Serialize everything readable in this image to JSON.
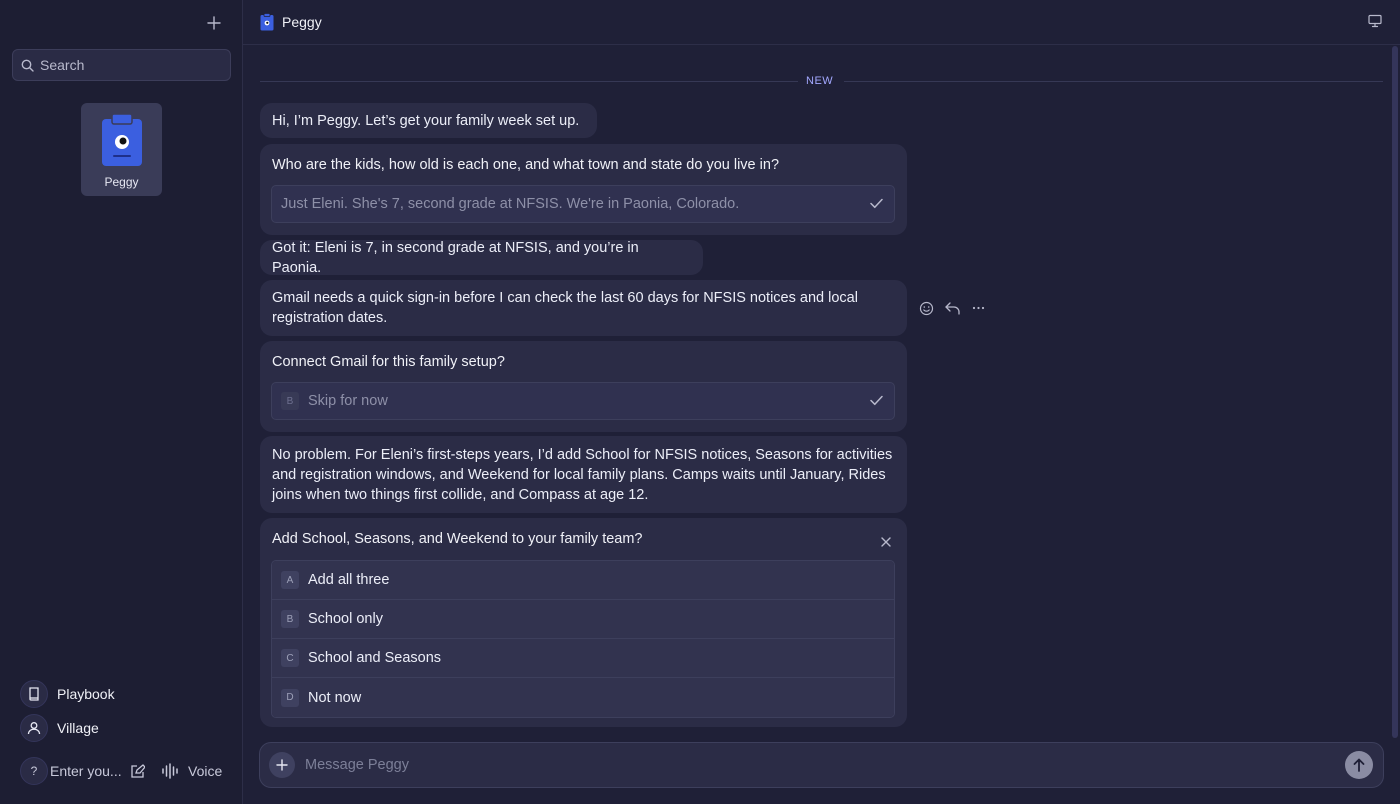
{
  "sidebar": {
    "search_placeholder": "Search",
    "agent": {
      "name": "Peggy",
      "icon": "clipboard-eye-icon"
    },
    "nav": [
      {
        "label": "Playbook",
        "icon": "book-icon"
      },
      {
        "label": "Village",
        "icon": "person-icon"
      }
    ],
    "bottom": {
      "help_label": "?",
      "input_placeholder": "Enter you...",
      "voice_label": "Voice"
    }
  },
  "header": {
    "title": "Peggy"
  },
  "divider": {
    "label": "NEW"
  },
  "messages": {
    "greeting": "Hi, I’m Peggy. Let’s get your family week set up.",
    "q1": {
      "question": "Who are the kids, how old is each one, and what town and state do you live in?",
      "answer": "Just Eleni. She's 7, second grade at NFSIS. We're in Paonia, Colorado."
    },
    "confirm": "Got it: Eleni is 7, in second grade at NFSIS, and you’re in Paonia.",
    "gmail_note": "Gmail needs a quick sign-in before I can check the last 60 days for NFSIS notices and local registration dates.",
    "q2": {
      "question": "Connect Gmail for this family setup?",
      "answer_key": "B",
      "answer": "Skip for now"
    },
    "plan": "No problem. For Eleni’s first-steps years, I’d add School for NFSIS notices, Seasons for activities and registration windows, and Weekend for local family plans. Camps waits until January, Rides joins when two things first collide, and Compass at age 12.",
    "q3": {
      "question": "Add School, Seasons, and Weekend to your family team?",
      "options": [
        {
          "key": "A",
          "label": "Add all three"
        },
        {
          "key": "B",
          "label": "School only"
        },
        {
          "key": "C",
          "label": "School and Seasons"
        },
        {
          "key": "D",
          "label": "Not now"
        }
      ]
    }
  },
  "composer": {
    "placeholder": "Message Peggy"
  },
  "colors": {
    "background": "#1f2037",
    "bubble": "#2b2c46",
    "accent": "#a3a8ff",
    "brand_icon": "#3b5fe0"
  }
}
